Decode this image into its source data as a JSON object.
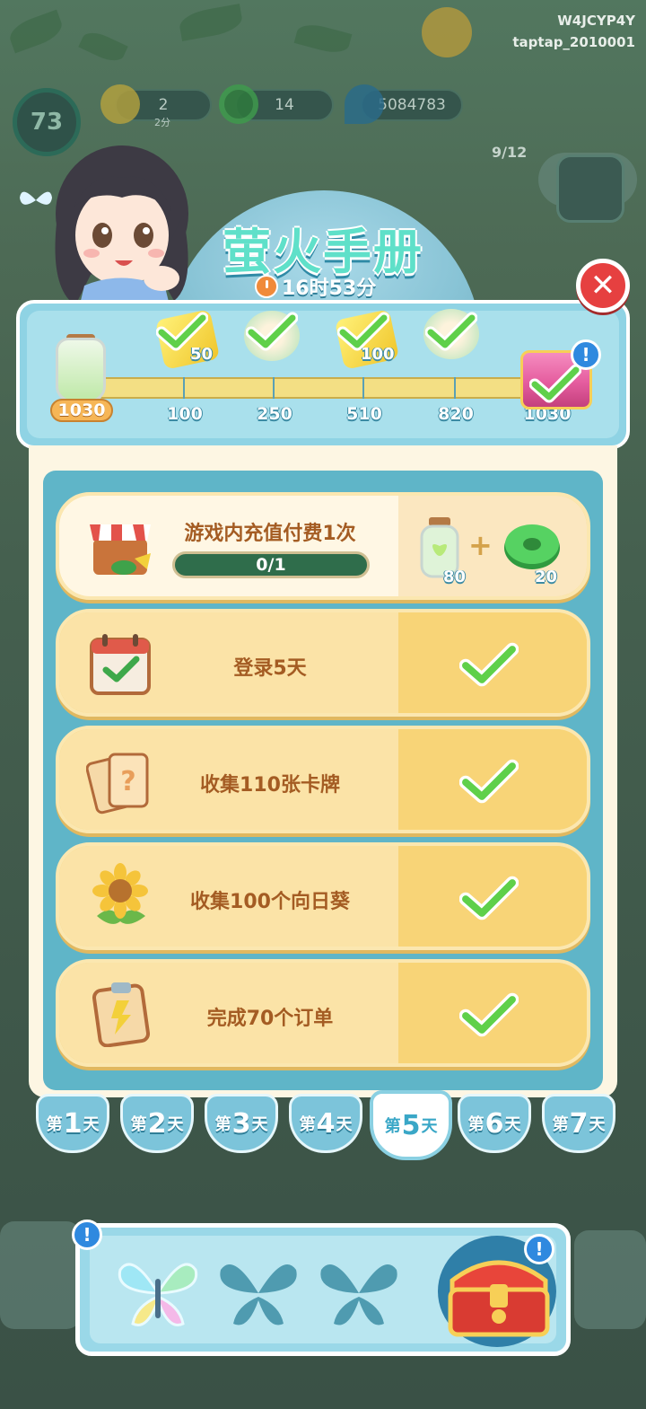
{
  "watermark": {
    "id": "W4JCYP4Y",
    "channel": "taptap_2010001"
  },
  "hud": {
    "level": "73",
    "energy": "2",
    "energy_sub": "2分",
    "coins": "14",
    "score": "5084783"
  },
  "popup": {
    "title": "萤火手册",
    "timer": "16时53分",
    "close_label": "✕"
  },
  "progress": {
    "current_label": "1030",
    "current_value": 1030,
    "milestones": [
      {
        "value": "100",
        "reward_amount": "50",
        "claimed": true
      },
      {
        "value": "250",
        "reward_amount": "",
        "claimed": true
      },
      {
        "value": "510",
        "reward_amount": "100",
        "claimed": true
      },
      {
        "value": "820",
        "reward_amount": "",
        "claimed": true
      },
      {
        "value": "1030",
        "reward_amount": "",
        "claimed": true,
        "alert": "!"
      }
    ]
  },
  "tasks": [
    {
      "label": "游戏内充值付费1次",
      "progress": "0/1",
      "rewards": [
        {
          "icon": "firefly-jar-icon",
          "amount": "80"
        },
        {
          "icon": "jade-coin-icon",
          "amount": "20"
        }
      ],
      "plus": "+",
      "done": false
    },
    {
      "label": "登录5天",
      "done": true
    },
    {
      "label": "收集110张卡牌",
      "done": true
    },
    {
      "label": "收集100个向日葵",
      "done": true
    },
    {
      "label": "完成70个订单",
      "done": true
    }
  ],
  "tabs": [
    {
      "prefix": "第",
      "num": "1",
      "suffix": "天",
      "active": false
    },
    {
      "prefix": "第",
      "num": "2",
      "suffix": "天",
      "active": false
    },
    {
      "prefix": "第",
      "num": "3",
      "suffix": "天",
      "active": false
    },
    {
      "prefix": "第",
      "num": "4",
      "suffix": "天",
      "active": false
    },
    {
      "prefix": "第",
      "num": "5",
      "suffix": "天",
      "active": true
    },
    {
      "prefix": "第",
      "num": "6",
      "suffix": "天",
      "active": false
    },
    {
      "prefix": "第",
      "num": "7",
      "suffix": "天",
      "active": false
    }
  ],
  "bottom": {
    "alert_left": "!",
    "alert_right": "!",
    "butterflies_collected": 1,
    "butterflies_total": 3
  },
  "colors": {
    "accent": "#5fe0c9",
    "panel": "#8fd3e4",
    "task": "#f7d47f",
    "check": "#5fd04a",
    "close": "#e64040"
  }
}
